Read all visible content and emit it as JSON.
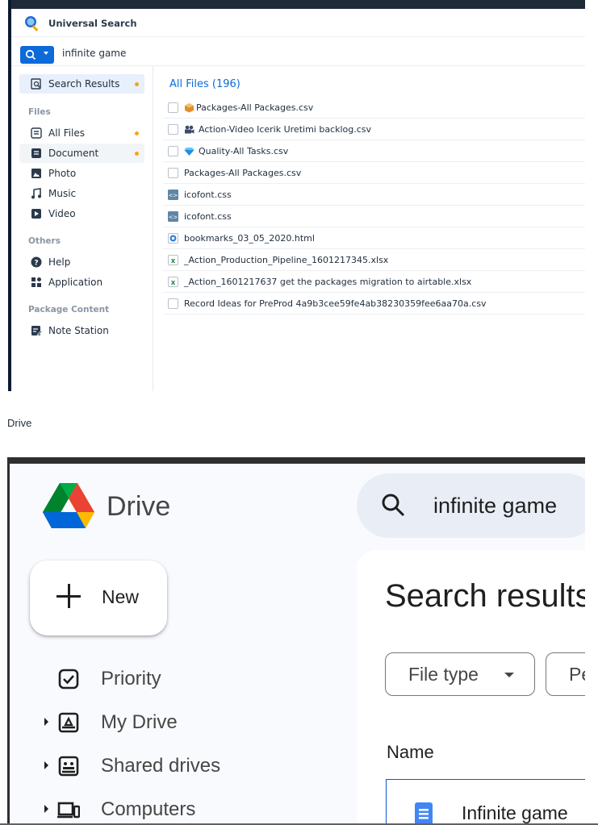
{
  "universal_search": {
    "title": "Universal Search",
    "query": "infinite game",
    "sidebar": {
      "search_results": "Search Results",
      "sections": {
        "files": "Files",
        "others": "Others",
        "package_content": "Package Content"
      },
      "items": {
        "all_files": "All Files",
        "document": "Document",
        "photo": "Photo",
        "music": "Music",
        "video": "Video",
        "help": "Help",
        "application": "Application",
        "note_station": "Note Station"
      }
    },
    "results_title": "All Files (196)",
    "results": [
      {
        "name": "Packages-All Packages.csv",
        "icon": "package-icon"
      },
      {
        "name": "Action-Video Icerik Uretimi backlog.csv",
        "icon": "video-team-icon"
      },
      {
        "name": "Quality-All Tasks.csv",
        "icon": "diamond-icon"
      },
      {
        "name": "Packages-All Packages.csv",
        "icon": "file-icon"
      },
      {
        "name": "icofont.css",
        "icon": "css-file-icon"
      },
      {
        "name": "icofont.css",
        "icon": "css-file-icon"
      },
      {
        "name": "bookmarks_03_05_2020.html",
        "icon": "html-file-icon"
      },
      {
        "name": "_Action_Production_Pipeline_1601217345.xlsx",
        "icon": "excel-file-icon"
      },
      {
        "name": "_Action_1601217637 get the packages migration to airtable.xlsx",
        "icon": "excel-file-icon"
      },
      {
        "name": "Record Ideas for PreProd 4a9b3cee59fe4ab38230359fee6aa70a.csv",
        "icon": "file-icon"
      }
    ]
  },
  "caption": "Drive",
  "drive": {
    "app_name": "Drive",
    "search_query": "infinite game",
    "new_label": "New",
    "nav": {
      "priority": "Priority",
      "my_drive": "My Drive",
      "shared_drives": "Shared drives",
      "computers": "Computers"
    },
    "main_title": "Search results",
    "chips": {
      "file_type": "File type",
      "people": "People"
    },
    "column_name": "Name",
    "first_file": "Infinite game"
  },
  "colors": {
    "synology_accent": "#0d6ad9",
    "dot_orange": "#f4a51c",
    "drive_blue": "#0b57d0"
  }
}
